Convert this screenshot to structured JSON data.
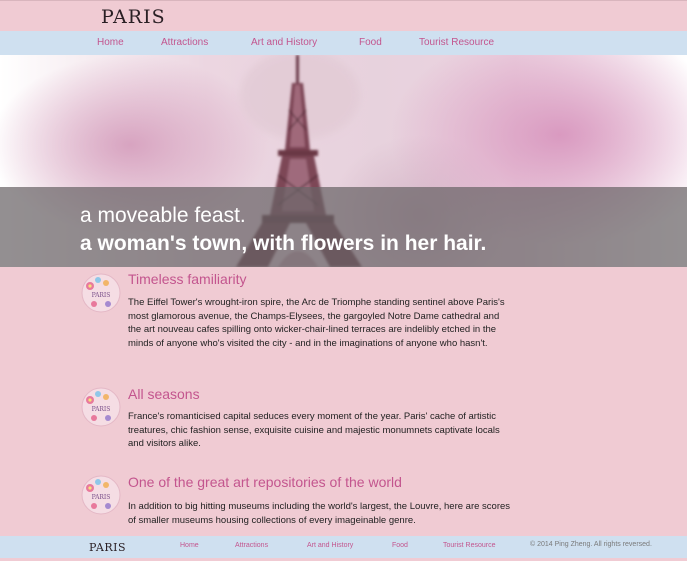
{
  "header": {
    "logo": "PARIS"
  },
  "nav": {
    "items": [
      {
        "label": "Home"
      },
      {
        "label": "Attractions"
      },
      {
        "label": "Art and History"
      },
      {
        "label": "Food"
      },
      {
        "label": "Tourist Resource"
      }
    ]
  },
  "hero": {
    "line1": "a moveable feast.",
    "line2": "a woman's town, with flowers in her hair."
  },
  "sections": [
    {
      "icon": "paris-flower-badge-icon",
      "title": "Timeless familiarity",
      "body": "The Eiffel Tower's wrought-iron spire, the Arc de Triomphe standing sentinel above Paris's most glamorous avenue, the Champs-Elysees, the gargoyled Notre Dame cathedral and the art nouveau cafes spilling onto wicker-chair-lined terraces are indelibly etched in the minds of anyone who's visited the city - and in the imaginations of anyone who hasn't."
    },
    {
      "icon": "paris-flower-badge-icon",
      "title": "All seasons",
      "body": "France's romanticised capital seduces every moment of the year. Paris' cache of artistic treatures, chic fashion sense, exquisite cuisine and majestic monumnets captivate locals and visitors alike."
    },
    {
      "icon": "paris-flower-badge-icon",
      "title": "One of the great art repositories of the world",
      "body": "In addition to big hitting museums including the world's largest, the Louvre, here are scores of smaller museums housing collections of every imageinable genre."
    }
  ],
  "footer": {
    "logo": "PARIS",
    "items": [
      {
        "label": "Home"
      },
      {
        "label": "Attractions"
      },
      {
        "label": "Art and History"
      },
      {
        "label": "Food"
      },
      {
        "label": "Tourist Resource"
      }
    ],
    "copyright": "© 2014 Ping Zheng. All rights reversed."
  },
  "colors": {
    "background": "#f0cbd3",
    "nav_background": "#cfe0f0",
    "accent": "#c3558e"
  }
}
